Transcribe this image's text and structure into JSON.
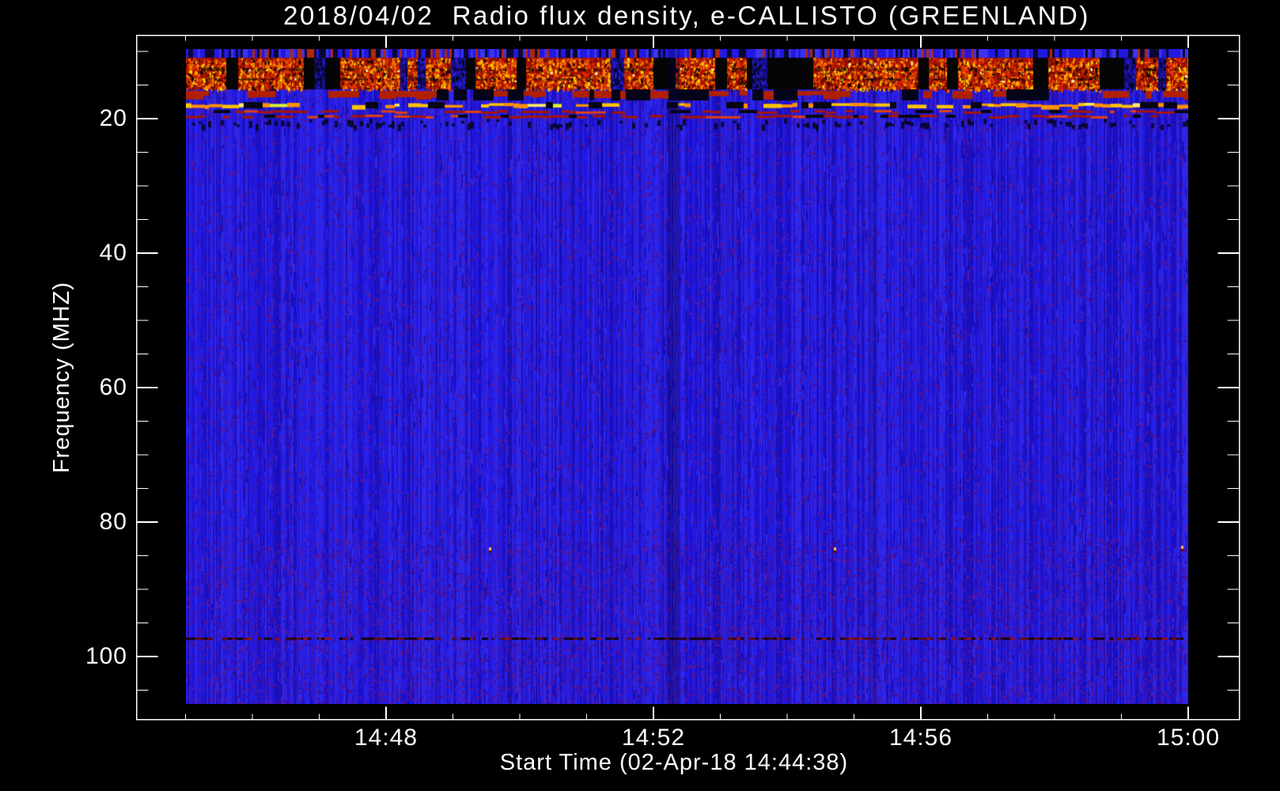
{
  "title": "2018/04/02  Radio flux density, e-CALLISTO (GREENLAND)",
  "x_axis": {
    "label": "Start Time (02-Apr-18 14:44:38)",
    "start_time_label": "14:44:38",
    "major_tick_labels": [
      "14:48",
      "14:52",
      "14:56",
      "15:00"
    ],
    "minor_tick_times": [
      "14:45",
      "14:46",
      "14:47",
      "14:49",
      "14:50",
      "14:51",
      "14:53",
      "14:54",
      "14:55",
      "14:57",
      "14:58",
      "14:59"
    ]
  },
  "y_axis": {
    "label": "Frequency (MHZ)",
    "major_tick_labels": [
      "20",
      "40",
      "60",
      "80",
      "100"
    ],
    "major_tick_values": [
      20,
      40,
      60,
      80,
      100
    ],
    "minor_tick_values": [
      10,
      15,
      25,
      30,
      35,
      45,
      50,
      55,
      65,
      70,
      75,
      85,
      90,
      95,
      105
    ],
    "inverted": true
  },
  "chart_data": {
    "type": "heatmap",
    "title": "2018/04/02  Radio flux density, e-CALLISTO (GREENLAND)",
    "xlabel": "Start Time (02-Apr-18 14:44:38)",
    "ylabel": "Frequency (MHZ)",
    "x_tick_labels": [
      "14:48",
      "14:52",
      "14:56",
      "15:00"
    ],
    "data_time_span": [
      "14:45:00",
      "15:00:00"
    ],
    "ylim_mhz": [
      7.5,
      109.5
    ],
    "data_freq_span_mhz": [
      9.6,
      107
    ],
    "y_axis_inverted": true,
    "legend": "none",
    "grid": "off",
    "background": "quiet solar radio background rendered as blue noise",
    "features": [
      {
        "name": "strong broadband RFI band",
        "freq_mhz": [
          10,
          20
        ],
        "time_span": [
          "14:45",
          "15:00"
        ],
        "appearance": "red/orange/yellow blocky bursts with black dropout patches"
      },
      {
        "name": "bright dashed interference line",
        "freq_mhz": 18,
        "time_span": [
          "14:45",
          "15:00"
        ],
        "appearance": "orange-yellow dashes"
      },
      {
        "name": "red dashed interference line",
        "freq_mhz": 19.5,
        "time_span": [
          "14:45",
          "15:00"
        ],
        "appearance": "dark red dashes"
      },
      {
        "name": "narrowband RFI channel",
        "freq_mhz": 97,
        "time_span": [
          "14:45",
          "15:00"
        ],
        "appearance": "dark red / black dashed horizontal line"
      },
      {
        "name": "isolated point bursts",
        "freq_mhz": 84,
        "times": [
          "14:49:32",
          "14:54:42",
          "14:59:54"
        ],
        "appearance": "small orange dots"
      },
      {
        "name": "faint dark vertical lane",
        "time": "14:52:18",
        "freq_mhz": [
          10,
          107
        ]
      },
      {
        "name": "fainter dark vertical lane",
        "time": "14:55:13",
        "freq_mhz": [
          10,
          107
        ]
      }
    ]
  },
  "colors": {
    "page_background": "#000000",
    "frame_and_text": "#ffffff",
    "base_blue": "#2019dc",
    "speckle_purple": "#54149a",
    "rfi_red": "#c81800",
    "rfi_orange": "#ff7a00",
    "rfi_yellow": "#ffd900",
    "rfi_hot_white": "#fff0b4",
    "dropout_black": "#050505",
    "rfi_line_dark_red": "#5c0a18"
  }
}
